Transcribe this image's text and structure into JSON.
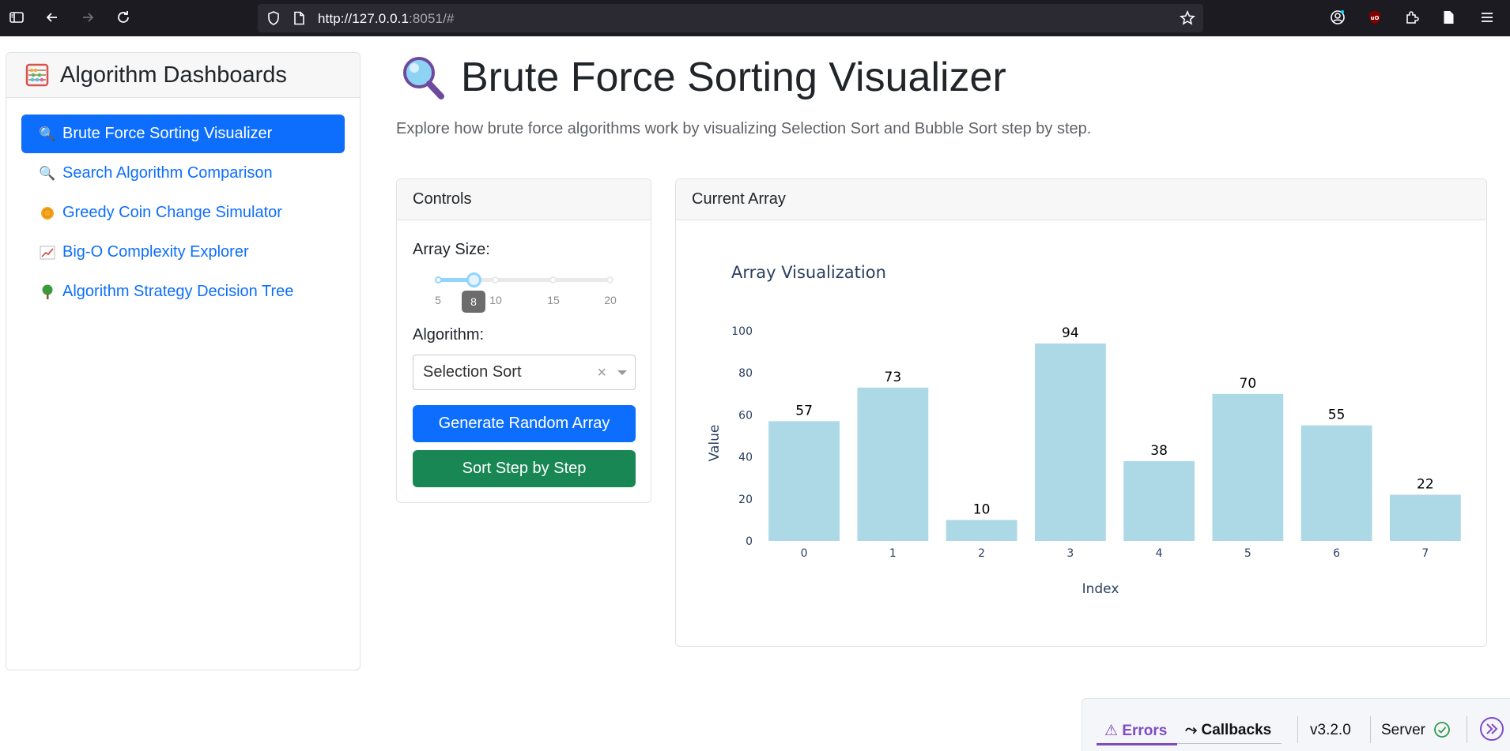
{
  "browser": {
    "url_host": "http://127.0.0.1",
    "url_rest": ":8051/#"
  },
  "sidebar": {
    "title": "Algorithm Dashboards",
    "items": [
      {
        "label": "Brute Force Sorting Visualizer",
        "icon": "magnifier-icon",
        "active": true
      },
      {
        "label": "Search Algorithm Comparison",
        "icon": "magnifier-icon",
        "active": false
      },
      {
        "label": "Greedy Coin Change Simulator",
        "icon": "coin-icon",
        "active": false
      },
      {
        "label": "Big-O Complexity Explorer",
        "icon": "chart-increasing-icon",
        "active": false
      },
      {
        "label": "Algorithm Strategy Decision Tree",
        "icon": "tree-icon",
        "active": false
      }
    ]
  },
  "main": {
    "title": "Brute Force Sorting Visualizer",
    "subtitle": "Explore how brute force algorithms work by visualizing Selection Sort and Bubble Sort step by step."
  },
  "controls": {
    "header": "Controls",
    "array_size_label": "Array Size:",
    "slider": {
      "min": 5,
      "max": 20,
      "value": 8,
      "marks": [
        "5",
        "10",
        "15",
        "20"
      ],
      "tooltip": "8"
    },
    "algorithm_label": "Algorithm:",
    "algorithm_value": "Selection Sort",
    "clear_glyph": "×",
    "generate_button": "Generate Random Array",
    "sort_button": "Sort Step by Step"
  },
  "array_card": {
    "header": "Current Array"
  },
  "chart_data": {
    "type": "bar",
    "title": "Array Visualization",
    "xlabel": "Index",
    "ylabel": "Value",
    "categories": [
      "0",
      "1",
      "2",
      "3",
      "4",
      "5",
      "6",
      "7"
    ],
    "values": [
      57,
      73,
      10,
      94,
      38,
      70,
      55,
      22
    ],
    "yticks": [
      "0",
      "20",
      "40",
      "60",
      "80",
      "100"
    ],
    "ylim": [
      0,
      100
    ],
    "bar_color": "#add8e6",
    "data_labels": true,
    "grid": false
  },
  "dash_debug": {
    "errors": "Errors",
    "callbacks": "Callbacks",
    "version": "v3.2.0",
    "server": "Server"
  }
}
